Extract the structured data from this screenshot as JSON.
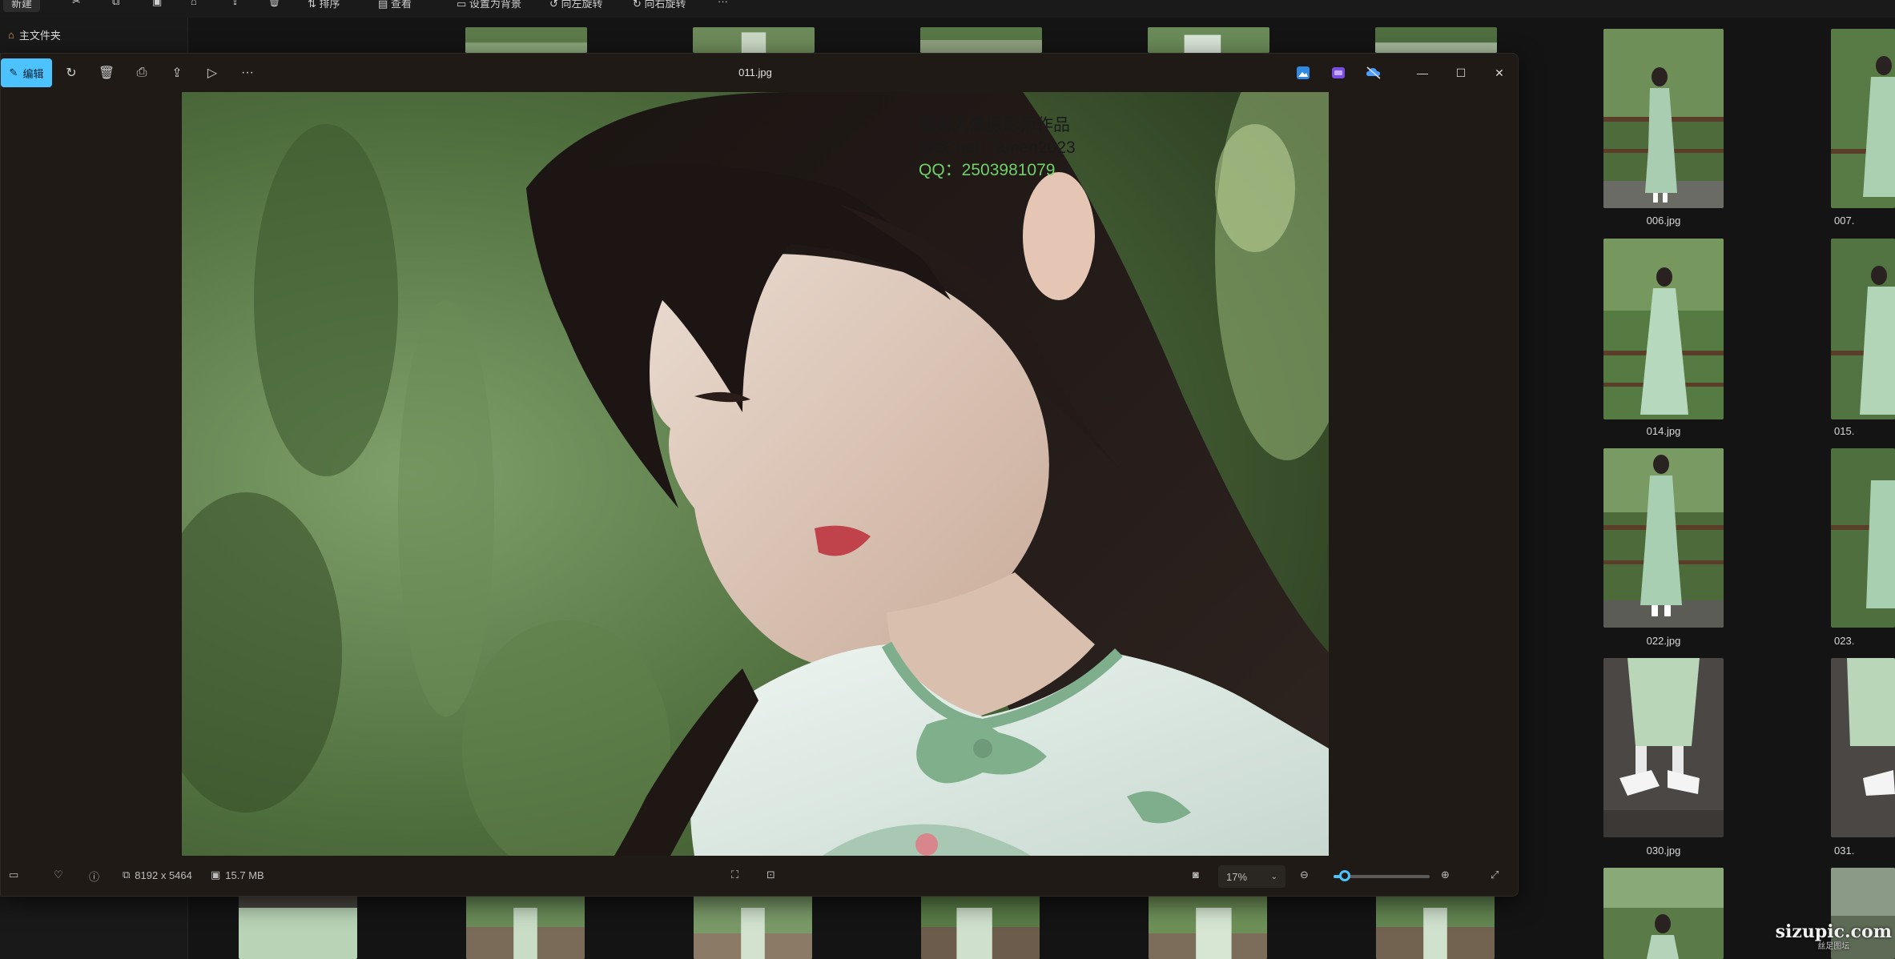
{
  "explorer": {
    "toolbar": {
      "new_label": "新建",
      "sort_label": "排序",
      "view_label": "查看",
      "set_bg_label": "设置为背景",
      "rotate_right_label": "向左旋转",
      "rotate_left_label": "向右旋转",
      "more_label": "···"
    },
    "nav": {
      "home_label": "主文件夹"
    },
    "right_column_files": [
      {
        "name": "006.jpg"
      },
      {
        "name": "014.jpg"
      },
      {
        "name": "022.jpg"
      },
      {
        "name": "030.jpg"
      }
    ],
    "far_right_files": [
      {
        "name": "007."
      },
      {
        "name": "015."
      },
      {
        "name": "023."
      },
      {
        "name": "031."
      }
    ],
    "site_watermark": "sizupic.com",
    "site_watermark_sub": "丝足图坛"
  },
  "viewer": {
    "title": "011.jpg",
    "edit_label": "编辑",
    "dimensions": "8192 x 5464",
    "file_size": "15.7 MB",
    "zoom_value": "17%",
    "zoom_level": 0.17,
    "photo_watermark": {
      "line1": "著名人像摄影师作品",
      "line2": "WeChat：amen2023",
      "line3": "QQ：2503981079"
    }
  },
  "colors": {
    "accent": "#4cc2ff",
    "viewer_bg": "#1f1a16",
    "explorer_bg": "#141414"
  }
}
